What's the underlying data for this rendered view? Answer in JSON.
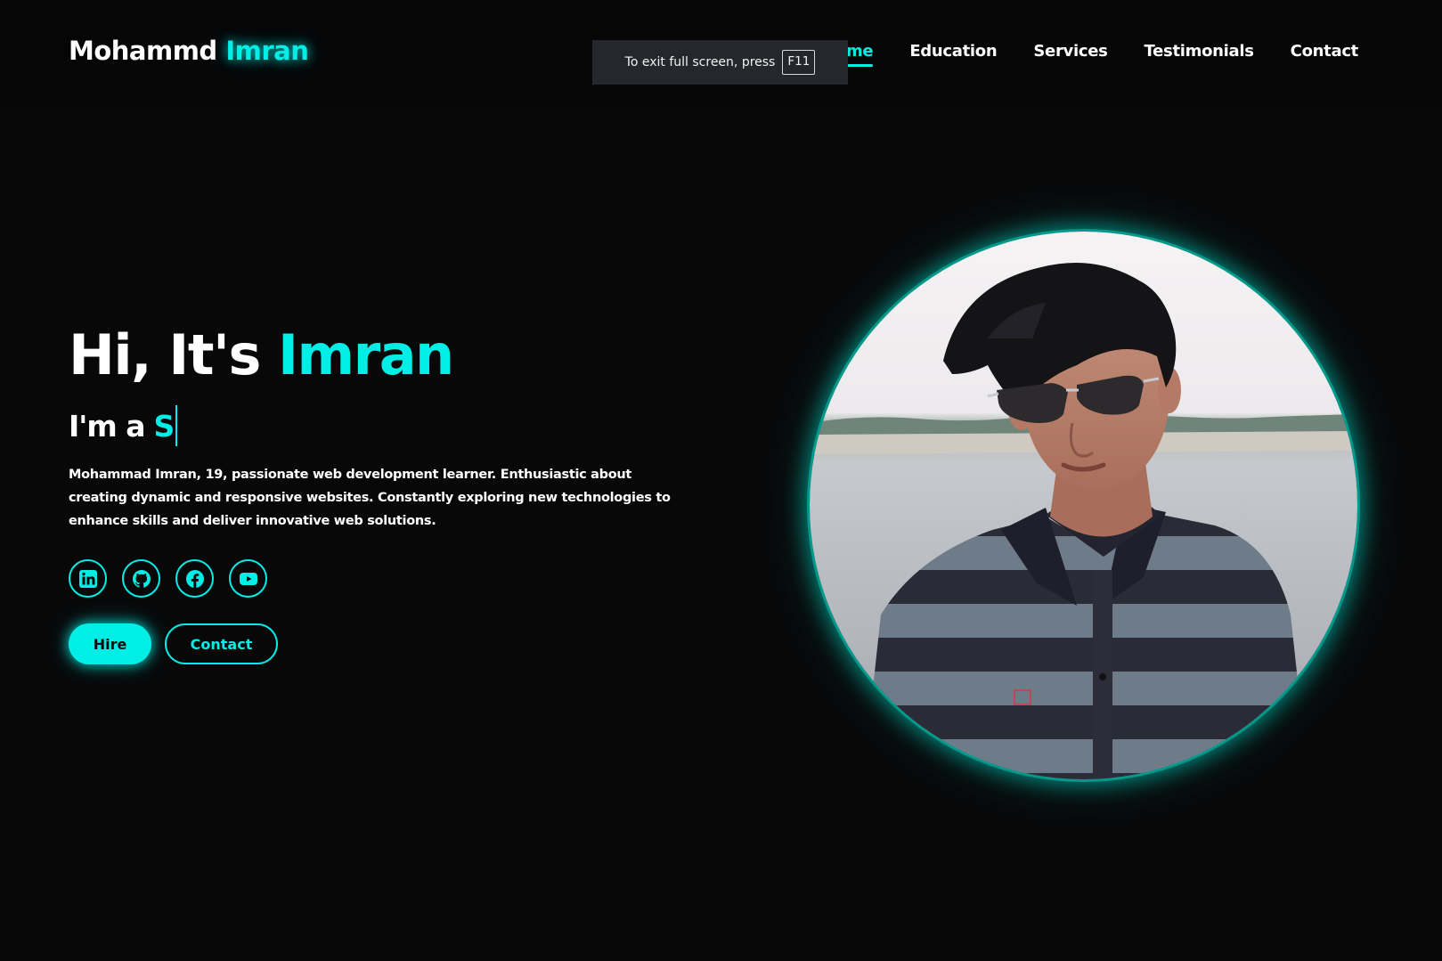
{
  "header": {
    "logo_first": "Mohammd",
    "logo_last": "Imran",
    "nav": [
      {
        "label": "Home",
        "active": true
      },
      {
        "label": "Education",
        "active": false
      },
      {
        "label": "Services",
        "active": false
      },
      {
        "label": "Testimonials",
        "active": false
      },
      {
        "label": "Contact",
        "active": false
      }
    ]
  },
  "fullscreen_notice": {
    "text": "To exit full screen, press",
    "key": "F11"
  },
  "hero": {
    "greeting": "Hi, It's",
    "name": "Imran",
    "role_prefix": "I'm a",
    "role_typed": "S",
    "description": "Mohammad Imran, 19, passionate web development learner. Enthusiastic about creating dynamic and responsive websites. Constantly exploring new technologies to enhance skills and deliver innovative web solutions.",
    "socials": [
      {
        "icon": "linkedin-icon"
      },
      {
        "icon": "github-icon"
      },
      {
        "icon": "facebook-icon"
      },
      {
        "icon": "youtube-icon"
      }
    ],
    "hire_label": "Hire",
    "contact_label": "Contact"
  },
  "colors": {
    "accent": "#00eee6",
    "background": "#080809",
    "toast_bg": "#24272c"
  }
}
